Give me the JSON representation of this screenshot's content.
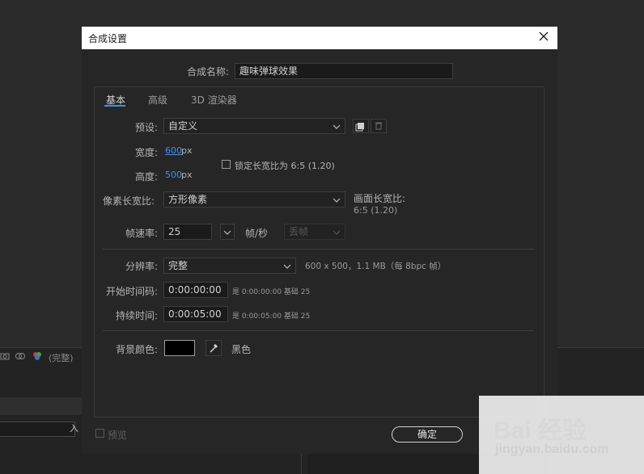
{
  "background": {
    "toolbar_text": "(完整)",
    "input_end_label": "入"
  },
  "dialog": {
    "title": "合成设置",
    "name_label": "合成名称:",
    "name_value": "趣味弹球效果",
    "tabs": [
      {
        "label": "基本",
        "active": true
      },
      {
        "label": "高级",
        "active": false
      },
      {
        "label": "3D 渲染器",
        "active": false
      }
    ],
    "preset": {
      "label": "预设:",
      "value": "自定义"
    },
    "width": {
      "label": "宽度:",
      "value": "600",
      "unit": "px"
    },
    "height": {
      "label": "高度:",
      "value": "500",
      "unit": "px"
    },
    "lock_aspect": {
      "label": "锁定长宽比为 6:5 (1.20)",
      "checked": false
    },
    "pixel_aspect": {
      "label": "像素长宽比:",
      "value": "方形像素"
    },
    "frame_aspect": {
      "label": "画面长宽比:",
      "value": "6:5 (1.20)"
    },
    "frame_rate": {
      "label": "帧速率:",
      "value": "25",
      "unit": "帧/秒",
      "drop_frame": "丢帧"
    },
    "resolution": {
      "label": "分辨率:",
      "value": "完整",
      "info": "600 x 500，1.1 MB（每 8bpc 帧）"
    },
    "start_timecode": {
      "label": "开始时间码:",
      "value": "0:00:00:00",
      "info": "是 0:00:00:00  基础 25"
    },
    "duration": {
      "label": "持续时间:",
      "value": "0:00:05:00",
      "info": "是 0:00:05:00  基础 25"
    },
    "bg_color": {
      "label": "背景颜色:",
      "name": "黑色",
      "color": "#000000"
    },
    "preview_label": "预览",
    "ok_label": "确定"
  },
  "watermark": {
    "main": "Bai 经验",
    "sub": "jingyan.baidu.com"
  },
  "colors": {
    "accent": "#3f8ff0",
    "dialog_bg": "#262626",
    "title_bg": "#ffffff"
  }
}
